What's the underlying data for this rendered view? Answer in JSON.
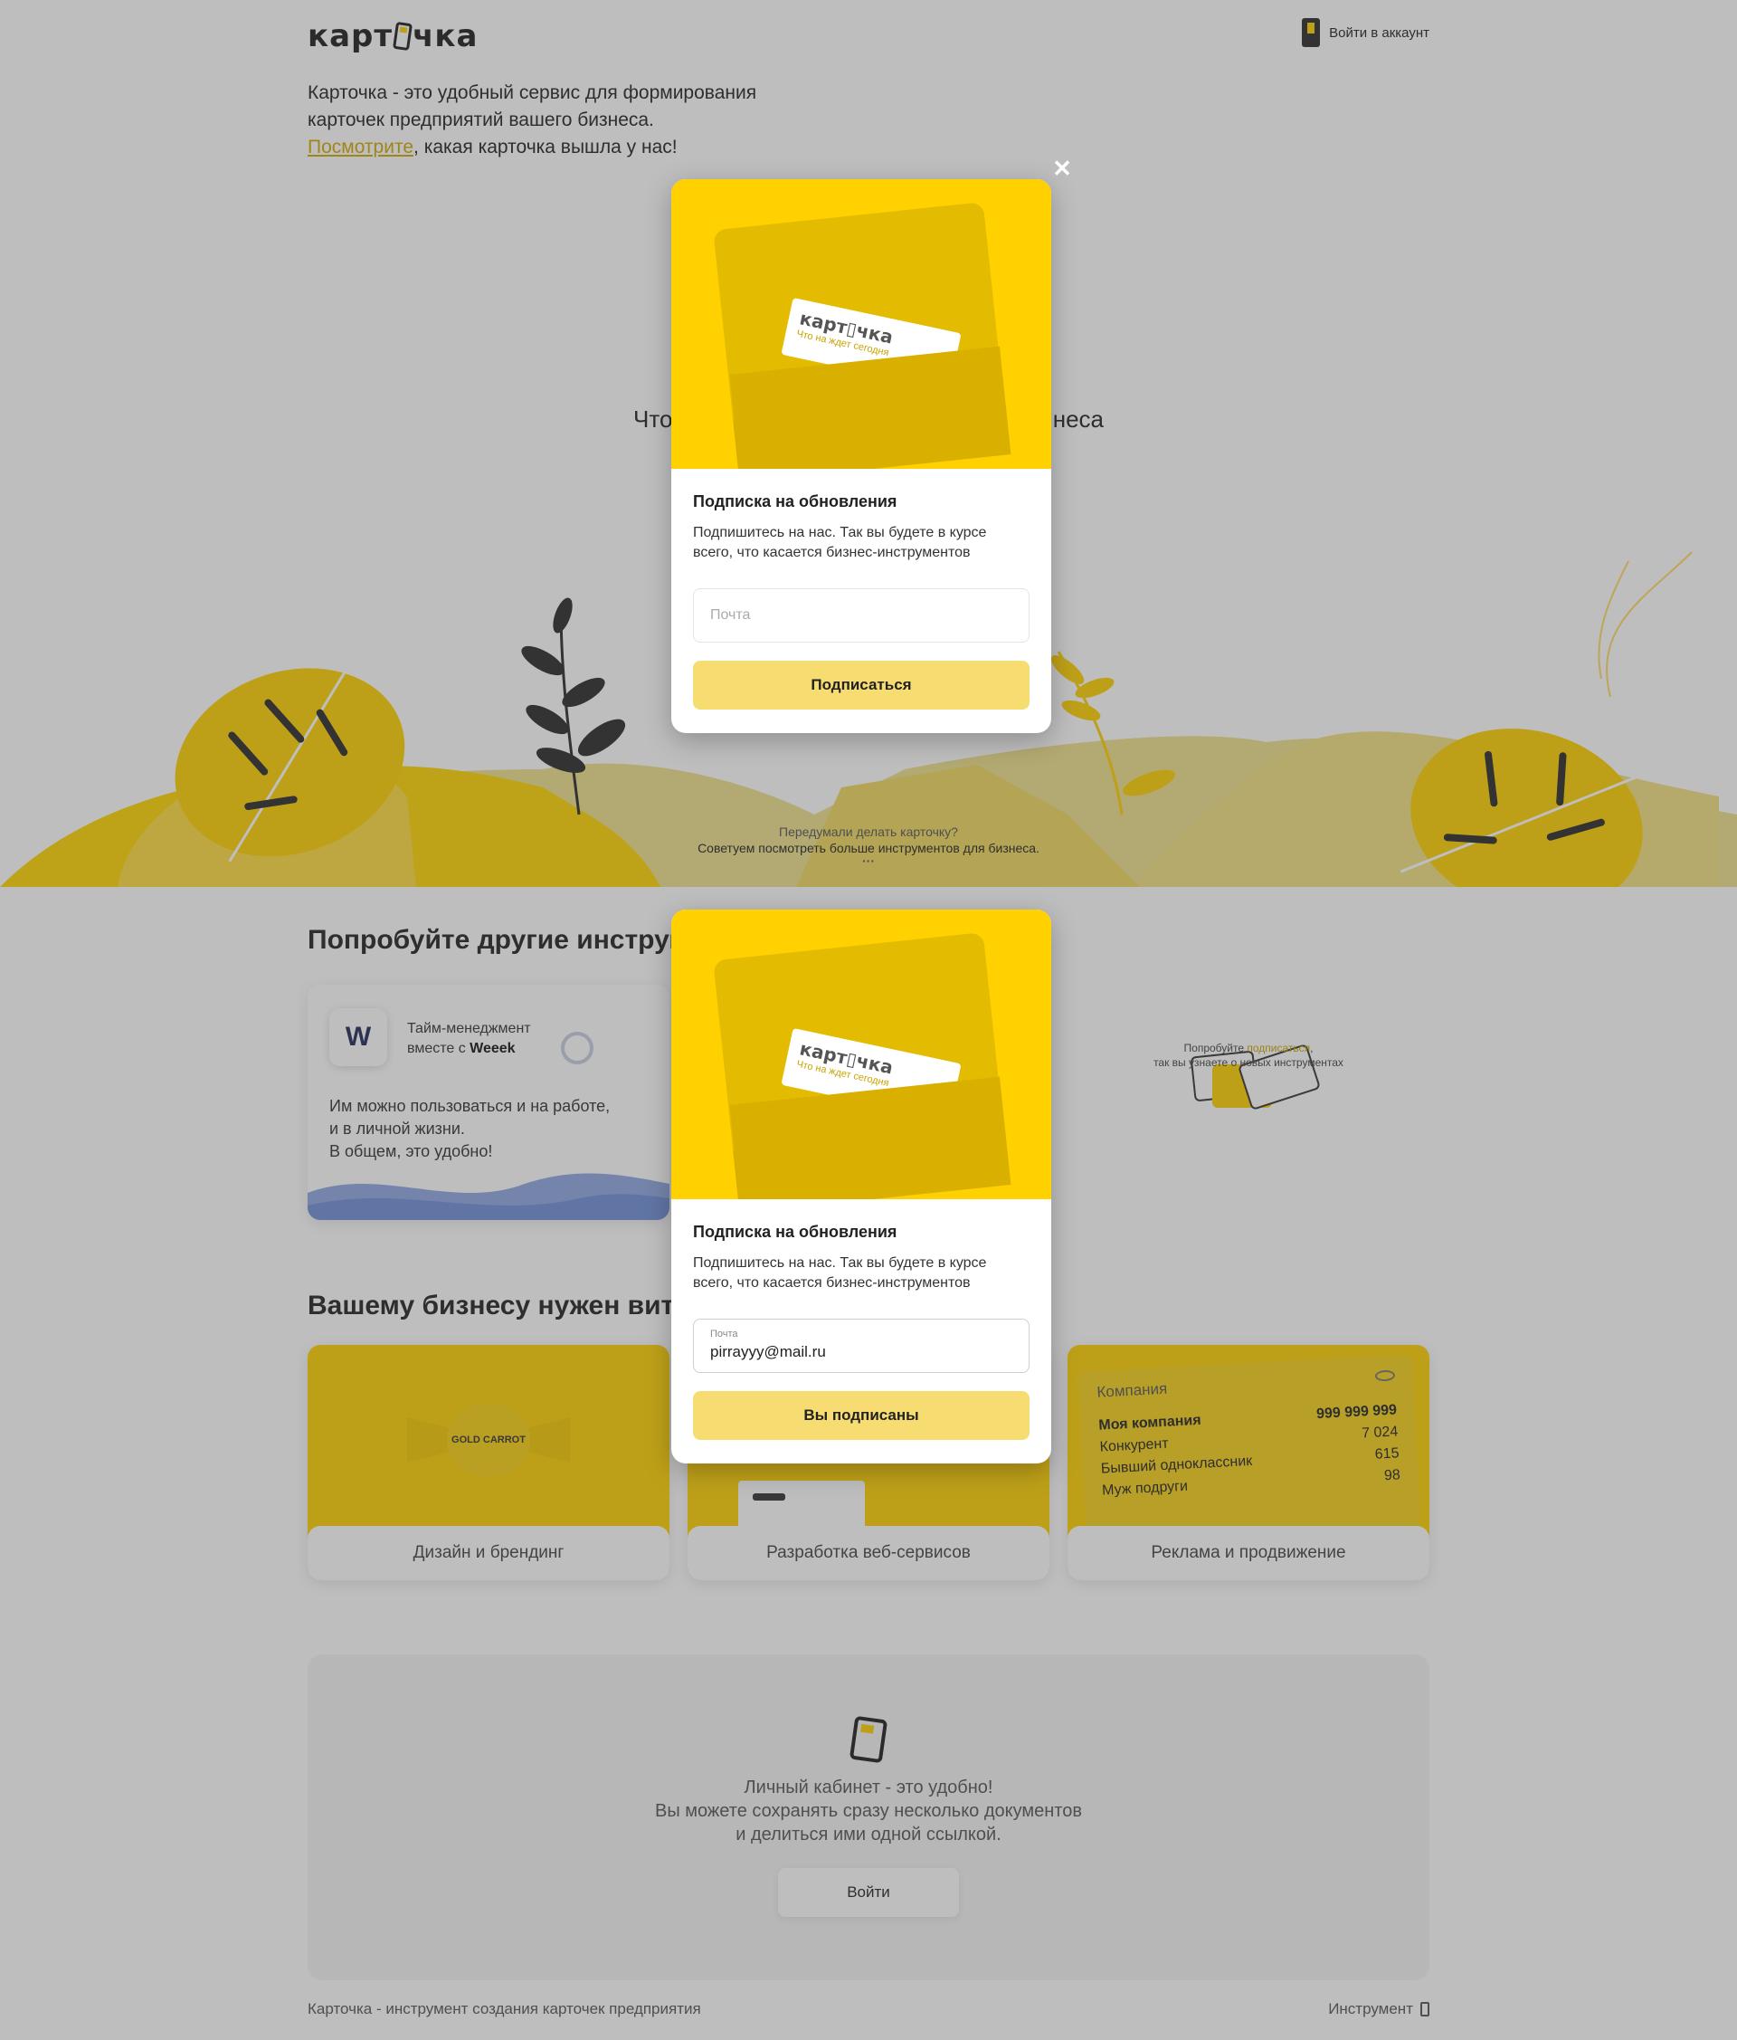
{
  "header": {
    "logo_text_left": "карт",
    "logo_text_right": "чка",
    "login_label": "Войти в аккаунт"
  },
  "intro": {
    "line1": "Карточка - это удобный сервис для формирования",
    "line2": "карточек предприятий вашего бизнеса.",
    "link": "Посмотрите",
    "line3_rest": ", какая карточка вышла у нас!"
  },
  "hero": {
    "title_left": "Что",
    "title_right": "неса",
    "bottom_line1": "Передумали делать карточку?",
    "bottom_line2": "Советуем посмотреть больше инструментов для бизнеса."
  },
  "tools_section": {
    "title": "Попробуйте другие инструм",
    "card": {
      "logo": "W",
      "head_line1": "Тайм-менеджмент",
      "head_line2_prefix": "вместе с ",
      "head_brand": "Weeek",
      "body_line1": "Им можно пользоваться и на работе,",
      "body_line2": "и в личной жизни.",
      "body_line3": "В общем, это удобно!"
    },
    "promo_prefix": "Попробуйте ",
    "promo_link": "подписаться",
    "promo_suffix": ",",
    "promo_line2": "так вы узнаете о новых инструментах"
  },
  "vitamins_section": {
    "title": "Вашему бизнесу нужен витам",
    "cards": [
      {
        "label": "Дизайн и брендинг",
        "candy_text": "GOLD CARROT"
      },
      {
        "label": "Разработка веб-сервисов"
      },
      {
        "label": "Реклама и продвижение",
        "table_title": "Компания",
        "rows": [
          {
            "name": "Моя компания",
            "value": "999 999 999"
          },
          {
            "name": "Конкурент",
            "value": "7 024"
          },
          {
            "name": "Бывший одноклассник",
            "value": "615"
          },
          {
            "name": "Муж подруги",
            "value": "98"
          }
        ]
      }
    ]
  },
  "cabinet": {
    "line1": "Личный кабинет - это удобно!",
    "line2": "Вы можете сохранять сразу несколько документов",
    "line3": "и делиться ими одной ссылкой.",
    "button": "Войти"
  },
  "footer": {
    "left": "Карточка - инструмент создания карточек предприятия",
    "right": "Инструмент"
  },
  "modal_common": {
    "card_logo": "карт▯чка",
    "card_tagline": "Что на ждет сегодня",
    "title": "Подписка на обновления",
    "desc_line1": "Подпишитесь на нас. Так вы будете в курсе",
    "desc_line2": "всего, что касается бизнес-инструментов"
  },
  "modal_empty": {
    "placeholder": "Почта",
    "button": "Подписаться"
  },
  "modal_filled": {
    "field_label": "Почта",
    "field_value": "pirrayyy@mail.ru",
    "button": "Вы подписаны"
  },
  "colors": {
    "accent": "#ffd100",
    "button": "#f7dc72",
    "overlay": "rgba(70,70,70,0.35)"
  }
}
